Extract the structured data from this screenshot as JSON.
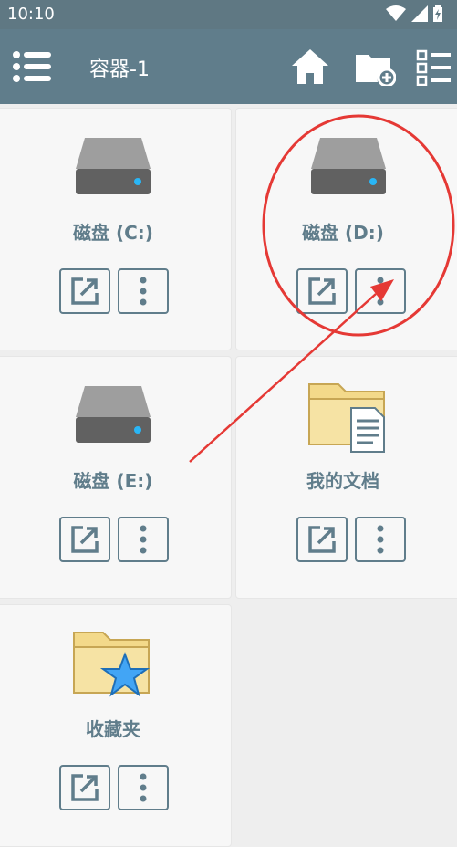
{
  "status": {
    "time": "10:10"
  },
  "appbar": {
    "title": "容器-1"
  },
  "items": [
    {
      "label": "磁盘 (C:)",
      "icon": "drive-icon"
    },
    {
      "label": "磁盘 (D:)",
      "icon": "drive-icon"
    },
    {
      "label": "磁盘 (E:)",
      "icon": "drive-icon"
    },
    {
      "label": "我的文档",
      "icon": "documents-folder-icon"
    },
    {
      "label": "收藏夹",
      "icon": "favorites-folder-icon"
    }
  ],
  "colors": {
    "appbar": "#607d8b",
    "accent_led": "#29b6f6",
    "annotation": "#e53935"
  }
}
